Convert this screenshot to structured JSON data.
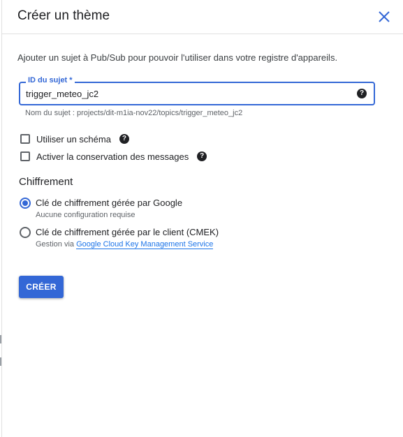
{
  "dialog": {
    "title": "Créer un thème",
    "description": "Ajouter un sujet à Pub/Sub pour pouvoir l'utiliser dans votre registre d'appareils.",
    "close_icon": "close-icon"
  },
  "topic_field": {
    "label": "ID du sujet *",
    "value": "trigger_meteo_jc2",
    "hint": "Nom du sujet : projects/dit-m1ia-nov22/topics/trigger_meteo_jc2",
    "help_icon": "help-icon"
  },
  "options": {
    "use_schema": {
      "label": "Utiliser un schéma",
      "checked": false
    },
    "retain_messages": {
      "label": "Activer la conservation des messages",
      "checked": false
    }
  },
  "encryption": {
    "title": "Chiffrement",
    "google_managed": {
      "label": "Clé de chiffrement gérée par Google",
      "sub": "Aucune configuration requise",
      "selected": true
    },
    "customer_managed": {
      "label": "Clé de chiffrement gérée par le client (CMEK)",
      "sub_prefix": "Gestion via",
      "link_text": "Google Cloud Key Management Service",
      "selected": false
    }
  },
  "actions": {
    "create_label": "CRÉER"
  },
  "colors": {
    "accent": "#3367d6",
    "text": "#202124",
    "muted": "#5f6368"
  }
}
